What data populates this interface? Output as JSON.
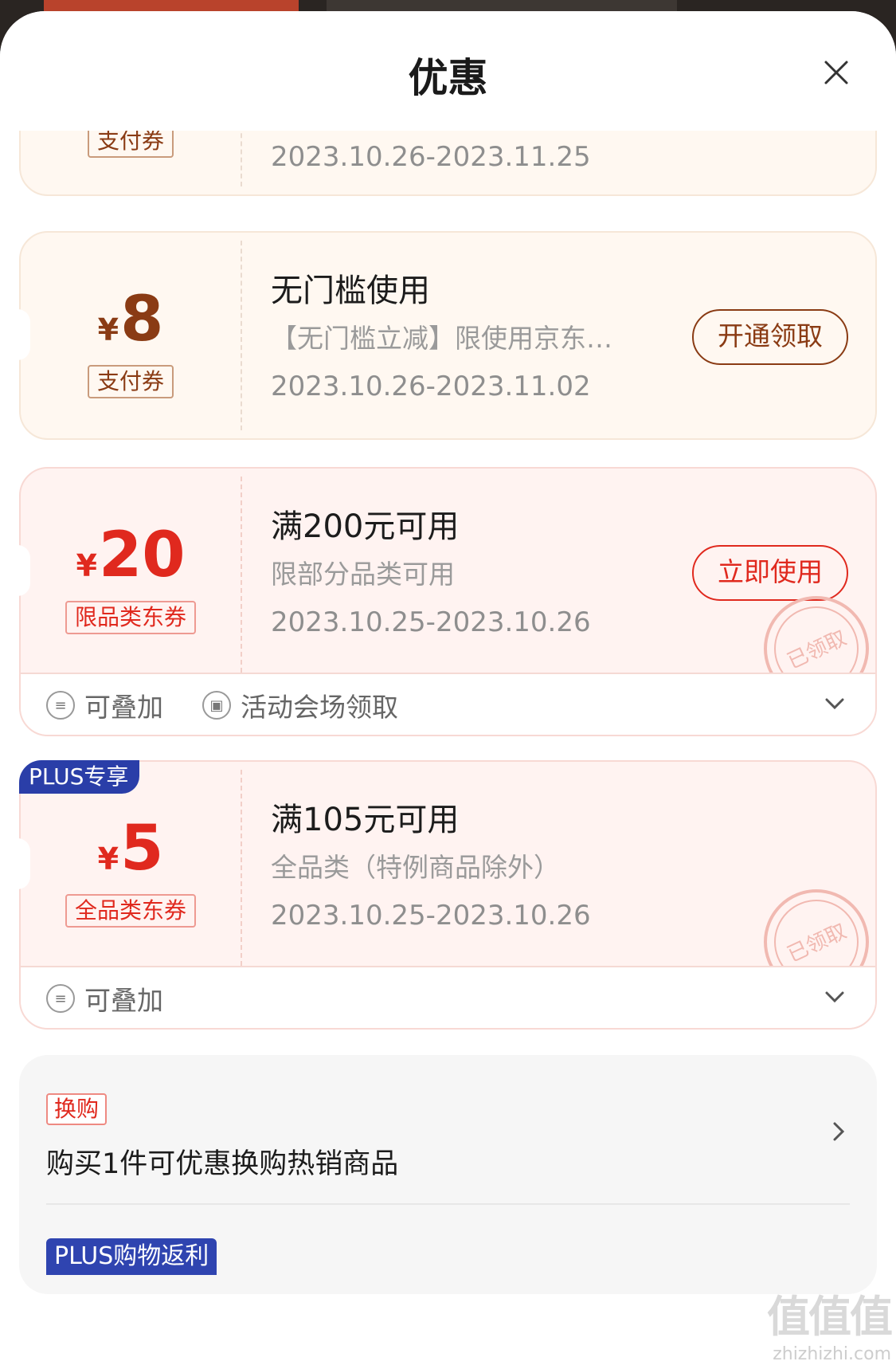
{
  "sheet": {
    "title": "优惠"
  },
  "coupons": [
    {
      "tag": "支付券",
      "date": "2023.10.26-2023.11.25"
    },
    {
      "yen": "¥",
      "amount": "8",
      "tag": "支付券",
      "title": "无门槛使用",
      "desc": "【无门槛立减】限使用京东…",
      "date": "2023.10.26-2023.11.02",
      "button": "开通领取"
    },
    {
      "yen": "¥",
      "amount": "20",
      "tag": "限品类东券",
      "title": "满200元可用",
      "desc": "限部分品类可用",
      "date": "2023.10.25-2023.10.26",
      "button": "立即使用",
      "stamp": "已领取",
      "features": [
        "可叠加",
        "活动会场领取"
      ]
    },
    {
      "badge": "PLUS专享",
      "yen": "¥",
      "amount": "5",
      "tag": "全品类东券",
      "title": "满105元可用",
      "desc": "全品类（特例商品除外）",
      "date": "2023.10.25-2023.10.26",
      "stamp": "已领取",
      "features": [
        "可叠加"
      ]
    }
  ],
  "exchange": {
    "tag": "换购",
    "text": "购买1件可优惠换购热销商品"
  },
  "plus_rebate": {
    "label": "PLUS购物返利"
  },
  "watermark": {
    "logo": "值值值",
    "url": "zhizhizhi.com"
  },
  "colors": {
    "brown": "#8a3b14",
    "red": "#e0291e",
    "plus_blue": "#2a3ea8"
  }
}
